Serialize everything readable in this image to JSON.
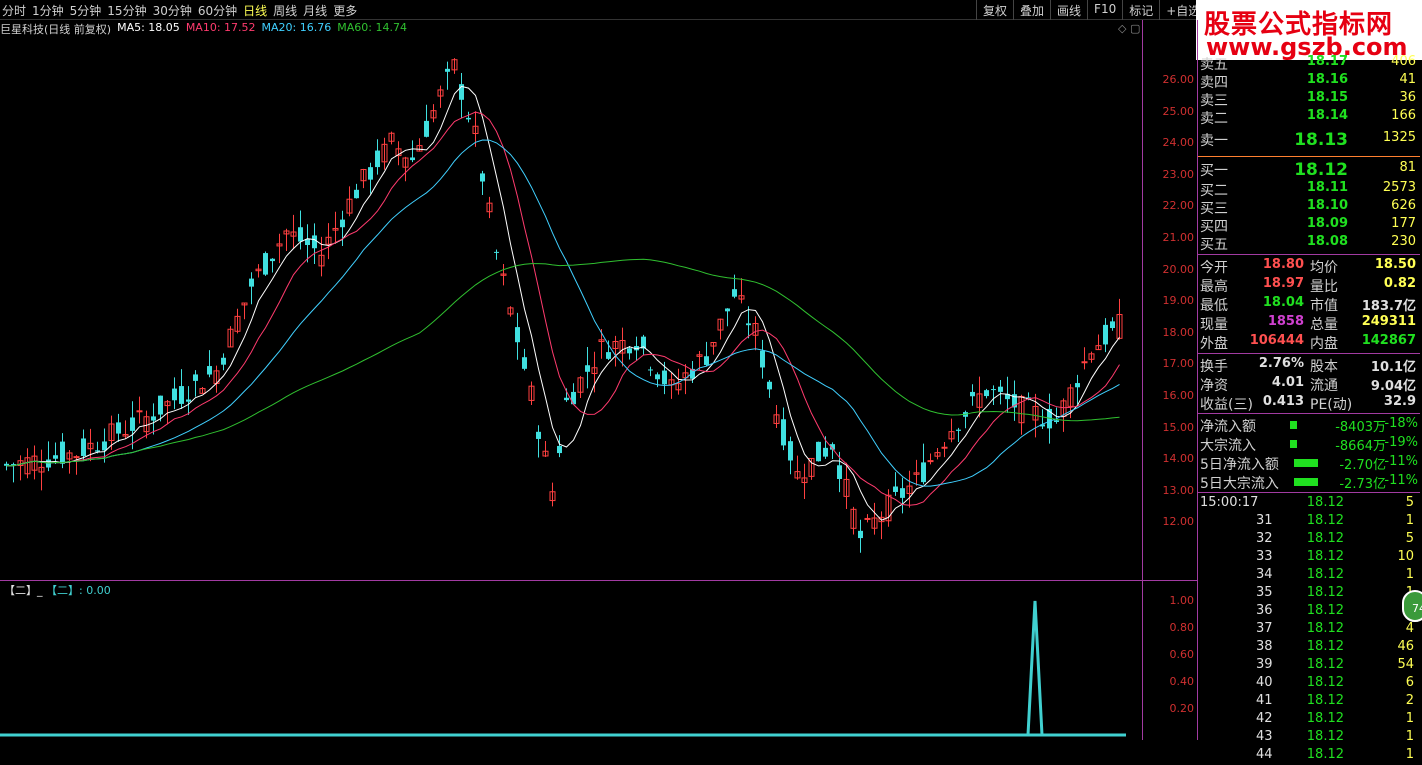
{
  "period_tabs": [
    "分时",
    "1分钟",
    "5分钟",
    "15分钟",
    "30分钟",
    "60分钟",
    "日线",
    "周线",
    "月线",
    "更多"
  ],
  "active_tab": "日线",
  "tool_buttons": [
    "复权",
    "叠加",
    "画线",
    "F10",
    "标记",
    "+自选"
  ],
  "watermark": {
    "title": "股票公式指标网",
    "url": "www.gszb.com"
  },
  "info": {
    "title": "巨星科技(日线 前复权)",
    "ma5": "MA5: 18.05",
    "ma10": "MA10: 17.52",
    "ma20": "MA20: 16.76",
    "ma60": "MA60: 14.74",
    "colors": {
      "ma5": "#ffffff",
      "ma10": "#ff3b6e",
      "ma20": "#40d0ff",
      "ma60": "#30c030"
    }
  },
  "price_axis": [
    "26.00",
    "25.00",
    "24.00",
    "23.00",
    "22.00",
    "21.00",
    "20.00",
    "19.00",
    "18.00",
    "17.00",
    "16.00",
    "15.00",
    "14.00",
    "13.00",
    "12.00"
  ],
  "indicator": {
    "header_a": "【二】_",
    "header_b": "【二】: 0.00",
    "axis": [
      "1.00",
      "0.80",
      "0.60",
      "0.40",
      "0.20"
    ]
  },
  "order_book": {
    "asks": [
      {
        "label": "卖五",
        "price": "18.17",
        "vol": "406"
      },
      {
        "label": "卖四",
        "price": "18.16",
        "vol": "41"
      },
      {
        "label": "卖三",
        "price": "18.15",
        "vol": "36"
      },
      {
        "label": "卖二",
        "price": "18.14",
        "vol": "166"
      },
      {
        "label": "卖一",
        "price": "18.13",
        "vol": "1325"
      }
    ],
    "bids": [
      {
        "label": "买一",
        "price": "18.12",
        "vol": "81"
      },
      {
        "label": "买二",
        "price": "18.11",
        "vol": "2573"
      },
      {
        "label": "买三",
        "price": "18.10",
        "vol": "626"
      },
      {
        "label": "买四",
        "price": "18.09",
        "vol": "177"
      },
      {
        "label": "买五",
        "price": "18.08",
        "vol": "230"
      }
    ]
  },
  "stats1": [
    {
      "l1": "今开",
      "v1": "18.80",
      "c1": "red",
      "l2": "均价",
      "v2": "18.50",
      "c2": "yellow"
    },
    {
      "l1": "最高",
      "v1": "18.97",
      "c1": "red",
      "l2": "量比",
      "v2": "0.82",
      "c2": "yellow"
    },
    {
      "l1": "最低",
      "v1": "18.04",
      "c1": "green",
      "l2": "市值",
      "v2": "183.7亿",
      "c2": "white"
    },
    {
      "l1": "现量",
      "v1": "1858",
      "c1": "purple",
      "l2": "总量",
      "v2": "249311",
      "c2": "yellow"
    },
    {
      "l1": "外盘",
      "v1": "106444",
      "c1": "red",
      "l2": "内盘",
      "v2": "142867",
      "c2": "green"
    }
  ],
  "stats2": [
    {
      "l1": "换手",
      "v1": "2.76%",
      "c1": "white",
      "l2": "股本",
      "v2": "10.1亿",
      "c2": "white"
    },
    {
      "l1": "净资",
      "v1": "4.01",
      "c1": "white",
      "l2": "流通",
      "v2": "9.04亿",
      "c2": "white"
    },
    {
      "l1": "收益(三)",
      "v1": "0.413",
      "c1": "white",
      "l2": "PE(动)",
      "v2": "32.9",
      "c2": "white"
    }
  ],
  "flows": [
    {
      "label": "净流入额",
      "value": "-8403万",
      "pct": "-18%",
      "bar": 0.15
    },
    {
      "label": "大宗流入",
      "value": "-8664万",
      "pct": "-19%",
      "bar": 0.15
    },
    {
      "label": "5日净流入额",
      "value": "-2.70亿",
      "pct": "-11%",
      "bar": 1
    },
    {
      "label": "5日大宗流入",
      "value": "-2.73亿",
      "pct": "-11%",
      "bar": 1
    }
  ],
  "ticks": [
    {
      "t": "15:00:17",
      "p": "18.12",
      "v": "5"
    },
    {
      "t": "31",
      "p": "18.12",
      "v": "1"
    },
    {
      "t": "32",
      "p": "18.12",
      "v": "5"
    },
    {
      "t": "33",
      "p": "18.12",
      "v": "10"
    },
    {
      "t": "34",
      "p": "18.12",
      "v": "1"
    },
    {
      "t": "35",
      "p": "18.12",
      "v": "1"
    },
    {
      "t": "36",
      "p": "18.12",
      "v": "9"
    },
    {
      "t": "37",
      "p": "18.12",
      "v": "4"
    },
    {
      "t": "38",
      "p": "18.12",
      "v": "46"
    },
    {
      "t": "39",
      "p": "18.12",
      "v": "54"
    },
    {
      "t": "40",
      "p": "18.12",
      "v": "6"
    },
    {
      "t": "41",
      "p": "18.12",
      "v": "2"
    },
    {
      "t": "42",
      "p": "18.12",
      "v": "1"
    },
    {
      "t": "43",
      "p": "18.12",
      "v": "1"
    },
    {
      "t": "44",
      "p": "18.12",
      "v": "1"
    }
  ],
  "badge": "74"
}
